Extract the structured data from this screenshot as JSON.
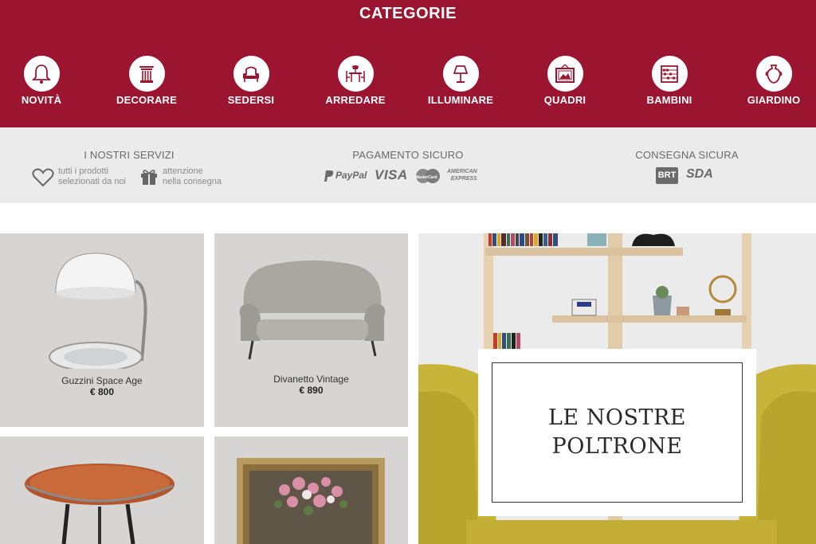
{
  "categories": {
    "title": "CATEGORIE",
    "items": [
      {
        "label": "NOVITÀ",
        "icon": "bell-icon"
      },
      {
        "label": "DECORARE",
        "icon": "column-icon"
      },
      {
        "label": "SEDERSI",
        "icon": "armchair-icon"
      },
      {
        "label": "ARREDARE",
        "icon": "table-chairs-icon"
      },
      {
        "label": "ILLUMINARE",
        "icon": "lamp-icon"
      },
      {
        "label": "QUADRI",
        "icon": "picture-frame-icon"
      },
      {
        "label": "BAMBINI",
        "icon": "abacus-icon"
      },
      {
        "label": "GIARDINO",
        "icon": "vase-icon"
      }
    ]
  },
  "services": {
    "ours": {
      "title": "I NOSTRI SERVIZI",
      "item1_line1": "tutti i prodotti",
      "item1_line2": "selezionati da noi",
      "item2_line1": "attenzione",
      "item2_line2": "nella consegna"
    },
    "payment": {
      "title": "PAGAMENTO SICURO",
      "paypal": "PayPal",
      "visa": "VISA",
      "mastercard": "MasterCard",
      "amex1": "AMERICAN",
      "amex2": "EXPRESS"
    },
    "delivery": {
      "title": "CONSEGNA SICURA",
      "brt": "BRT",
      "sda": "SDA"
    }
  },
  "products": [
    {
      "name": "Guzzini Space Age",
      "price": "€ 800"
    },
    {
      "name": "Divanetto Vintage",
      "price": "€ 890"
    }
  ],
  "hero": {
    "line1": "LE NOSTRE",
    "line2": "POLTRONE"
  },
  "colors": {
    "brand": "#9b1531",
    "band_gray": "#ebebeb",
    "tile_gray": "#d6d5d4",
    "armchair_yellow": "#c9b43a"
  }
}
